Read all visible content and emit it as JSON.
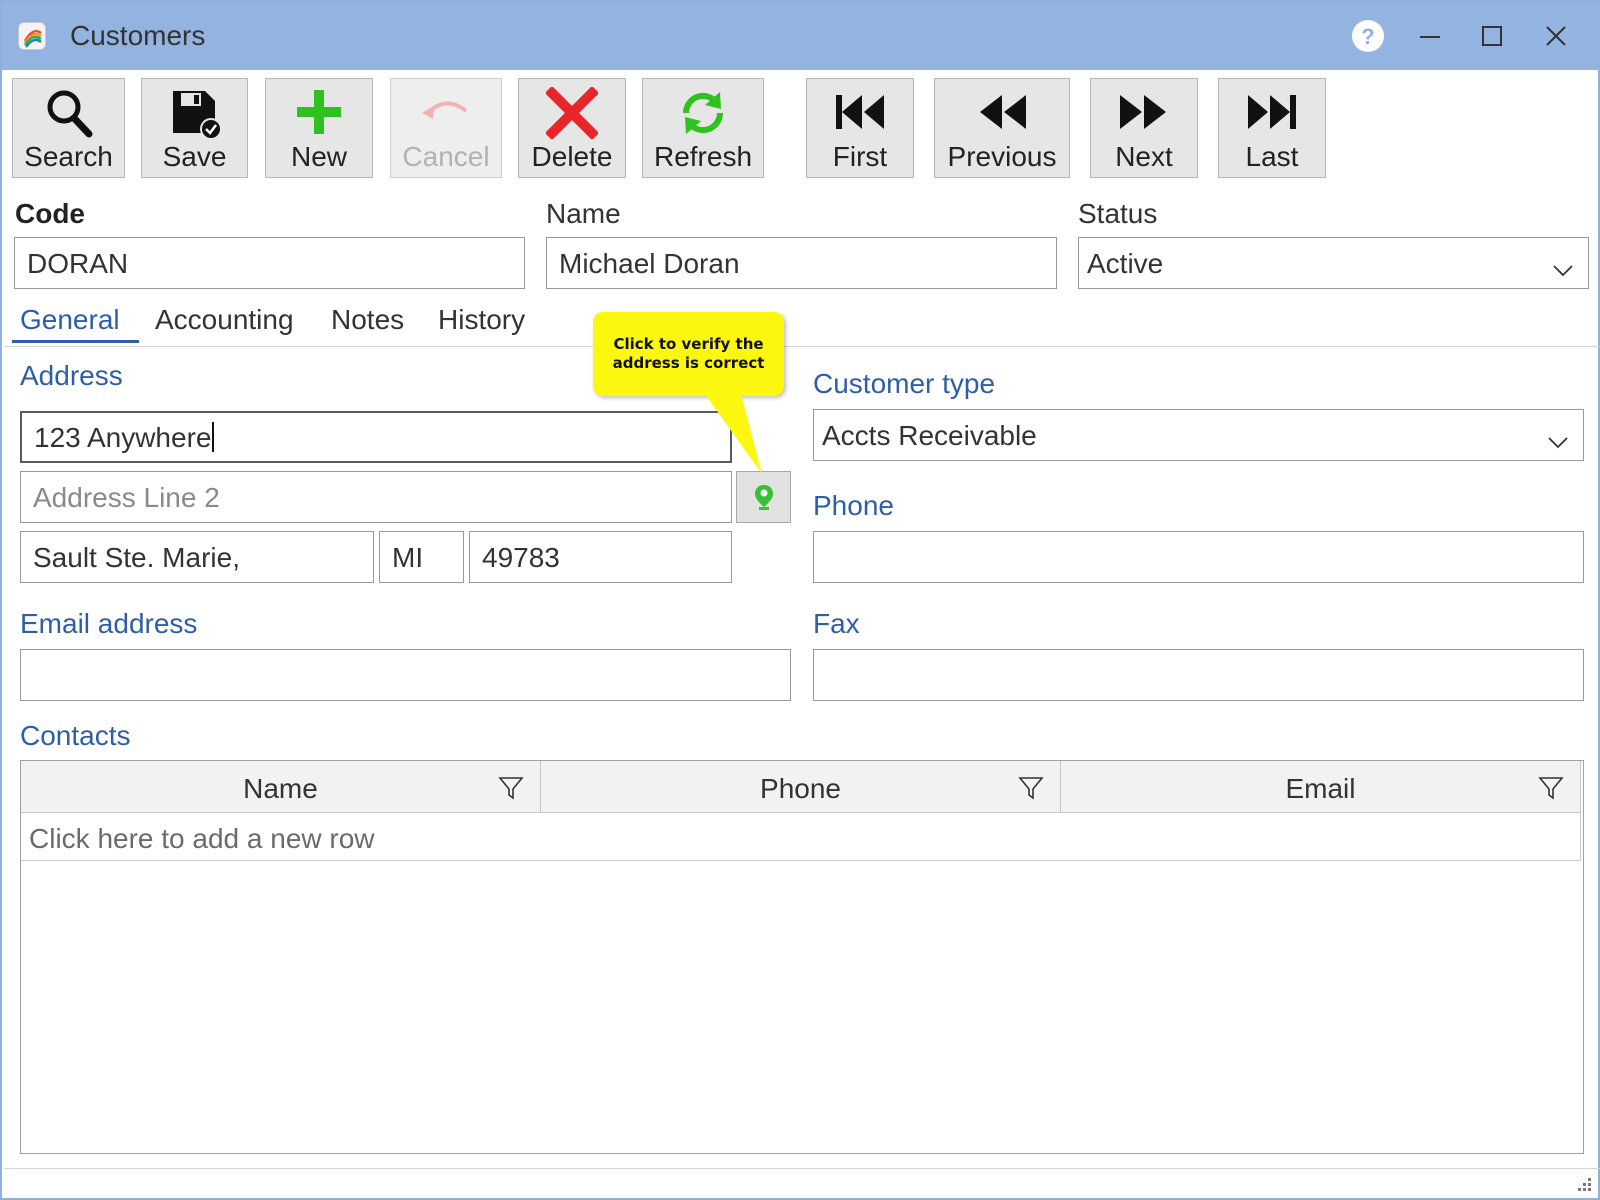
{
  "window": {
    "title": "Customers",
    "icon": "app-logo-icon",
    "controls": [
      "help-icon",
      "minimize-icon",
      "maximize-icon",
      "close-icon"
    ]
  },
  "toolbar": {
    "search": {
      "label": "Search",
      "icon": "search-icon"
    },
    "save": {
      "label": "Save",
      "icon": "save-icon"
    },
    "new": {
      "label": "New",
      "icon": "plus-icon"
    },
    "cancel": {
      "label": "Cancel",
      "icon": "undo-icon",
      "enabled": false
    },
    "delete": {
      "label": "Delete",
      "icon": "delete-x-icon"
    },
    "refresh": {
      "label": "Refresh",
      "icon": "refresh-icon"
    },
    "first": {
      "label": "First",
      "icon": "first-record-icon"
    },
    "previous": {
      "label": "Previous",
      "icon": "rewind-icon"
    },
    "next": {
      "label": "Next",
      "icon": "fast-forward-icon"
    },
    "last": {
      "label": "Last",
      "icon": "last-record-icon"
    }
  },
  "header": {
    "code": {
      "label": "Code",
      "value": "DORAN"
    },
    "name": {
      "label": "Name",
      "value": "Michael Doran"
    },
    "status": {
      "label": "Status",
      "value": "Active"
    }
  },
  "tabs": [
    {
      "label": "General",
      "active": true
    },
    {
      "label": "Accounting",
      "active": false
    },
    {
      "label": "Notes",
      "active": false
    },
    {
      "label": "History",
      "active": false
    }
  ],
  "general": {
    "address": {
      "label": "Address",
      "line1": "123 Anywhere",
      "line2_placeholder": "Address Line 2",
      "city": "Sault Ste. Marie,",
      "state": "MI",
      "zip": "49783",
      "verify_icon": "map-pin-icon"
    },
    "tooltip": {
      "line1": "Click to verify the",
      "line2": "address is correct"
    },
    "customer_type": {
      "label": "Customer type",
      "value": "Accts Receivable"
    },
    "phone": {
      "label": "Phone",
      "value": ""
    },
    "email": {
      "label": "Email address",
      "value": ""
    },
    "fax": {
      "label": "Fax",
      "value": ""
    },
    "contacts": {
      "label": "Contacts",
      "columns": [
        "Name",
        "Phone",
        "Email"
      ],
      "new_row_text": "Click here to add a new row",
      "rows": []
    }
  },
  "colors": {
    "titlebar": "#93b3e0",
    "accent": "#2f5ea8",
    "tooltip": "#fcf70f",
    "new_green": "#2fc21f",
    "delete_red": "#e8262a"
  }
}
